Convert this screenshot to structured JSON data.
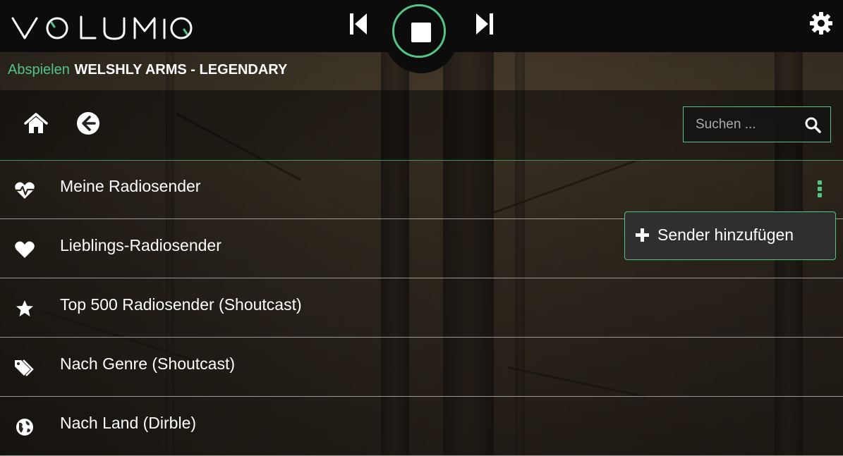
{
  "header": {
    "logo_text": "volumio",
    "controls": {
      "prev": "previous-track",
      "stop": "stop",
      "next": "next-track"
    }
  },
  "now_playing": {
    "label": "Abspielen",
    "title": "WELSHLY ARMS - LEGENDARY"
  },
  "toolbar": {
    "search_placeholder": "Suchen ..."
  },
  "list": [
    {
      "label": "Meine Radiosender",
      "icon": "heartbeat-icon"
    },
    {
      "label": "Lieblings-Radiosender",
      "icon": "heart-icon"
    },
    {
      "label": "Top 500 Radiosender (Shoutcast)",
      "icon": "star-icon"
    },
    {
      "label": "Nach Genre (Shoutcast)",
      "icon": "tags-icon"
    },
    {
      "label": "Nach Land (Dirble)",
      "icon": "globe-icon"
    }
  ],
  "dropdown": {
    "items": [
      {
        "label": "Sender hinzufügen",
        "icon": "plus-icon"
      }
    ]
  },
  "colors": {
    "accent": "#54c485",
    "topbar": "#0c0c0c"
  }
}
